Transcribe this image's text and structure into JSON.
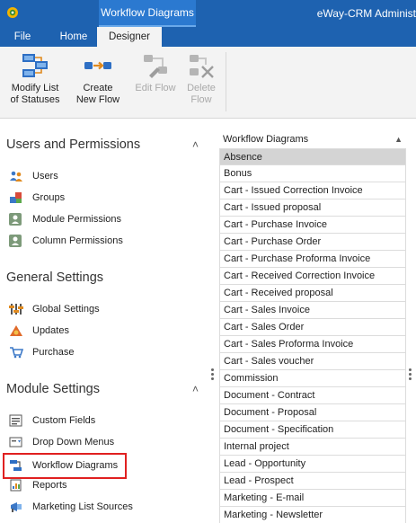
{
  "titlebar": {
    "context_tab": "Workflow Diagrams",
    "app_title": "eWay-CRM Administ",
    "logo_icon": "eway-logo-icon"
  },
  "tabs": [
    {
      "label": "File"
    },
    {
      "label": "Home"
    },
    {
      "label": "Designer"
    }
  ],
  "ribbon": {
    "modify_line1": "Modify List",
    "modify_line2": "of Statuses",
    "create_line1": "Create",
    "create_line2": "New Flow",
    "edit_label": "Edit Flow",
    "delete_line1": "Delete",
    "delete_line2": "Flow"
  },
  "sections": {
    "users": {
      "title": "Users and Permissions",
      "items": [
        "Users",
        "Groups",
        "Module Permissions",
        "Column Permissions"
      ]
    },
    "general": {
      "title": "General Settings",
      "items": [
        "Global Settings",
        "Updates",
        "Purchase"
      ]
    },
    "module": {
      "title": "Module Settings",
      "items": [
        "Custom Fields",
        "Drop Down Menus",
        "Workflow Diagrams",
        "Reports",
        "Marketing List Sources"
      ]
    }
  },
  "list": {
    "header": "Workflow Diagrams",
    "rows": [
      "Absence",
      "Bonus",
      "Cart - Issued Correction Invoice",
      "Cart - Issued proposal",
      "Cart - Purchase Invoice",
      "Cart - Purchase Order",
      "Cart - Purchase Proforma Invoice",
      "Cart - Received Correction Invoice",
      "Cart - Received proposal",
      "Cart - Sales Invoice",
      "Cart - Sales Order",
      "Cart - Sales Proforma Invoice",
      "Cart - Sales voucher",
      "Commission",
      "Document - Contract",
      "Document - Proposal",
      "Document - Specification",
      "Internal project",
      "Lead - Opportunity",
      "Lead - Prospect",
      "Marketing - E-mail",
      "Marketing - Newsletter"
    ]
  },
  "colors": {
    "titlebar": "#1e62b0",
    "context_tab": "#2b79d0",
    "ribbon": "#f3f3f3",
    "selected_row": "#d4d4d4",
    "highlight_outline": "#e02020"
  }
}
